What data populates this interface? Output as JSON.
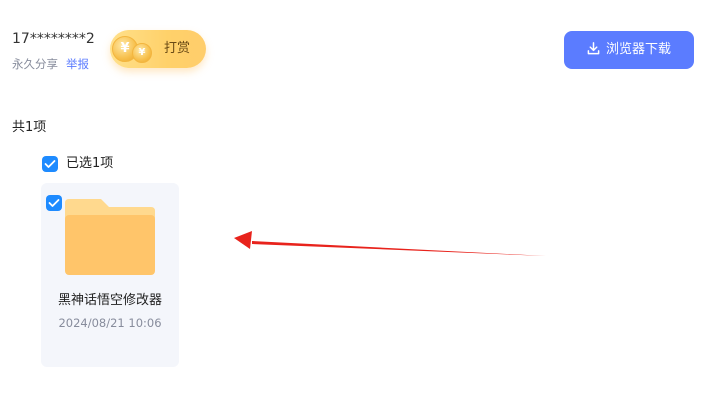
{
  "header": {
    "sharer_name": "17********2",
    "share_type": "永久分享",
    "report_label": "举报",
    "tip_button": {
      "label": "打赏",
      "coin_symbol": "¥"
    },
    "download_button": {
      "label": "浏览器下载",
      "icon": "download-icon"
    }
  },
  "listing": {
    "total_count_label": "共1项",
    "selected_label": "已选1项",
    "select_all_checked": true
  },
  "files": [
    {
      "name": "黑神话悟空修改器",
      "date": "2024/08/21 10:06",
      "type_icon": "folder-icon",
      "checked": true
    }
  ],
  "annotation": {
    "type": "arrow",
    "color": "#e8231c"
  },
  "colors": {
    "accent": "#5b7cff",
    "checkbox": "#1e8bff",
    "folder": "#ffc56a",
    "tip_gold": "#ffd16a",
    "card_background": "#f4f6fb"
  }
}
